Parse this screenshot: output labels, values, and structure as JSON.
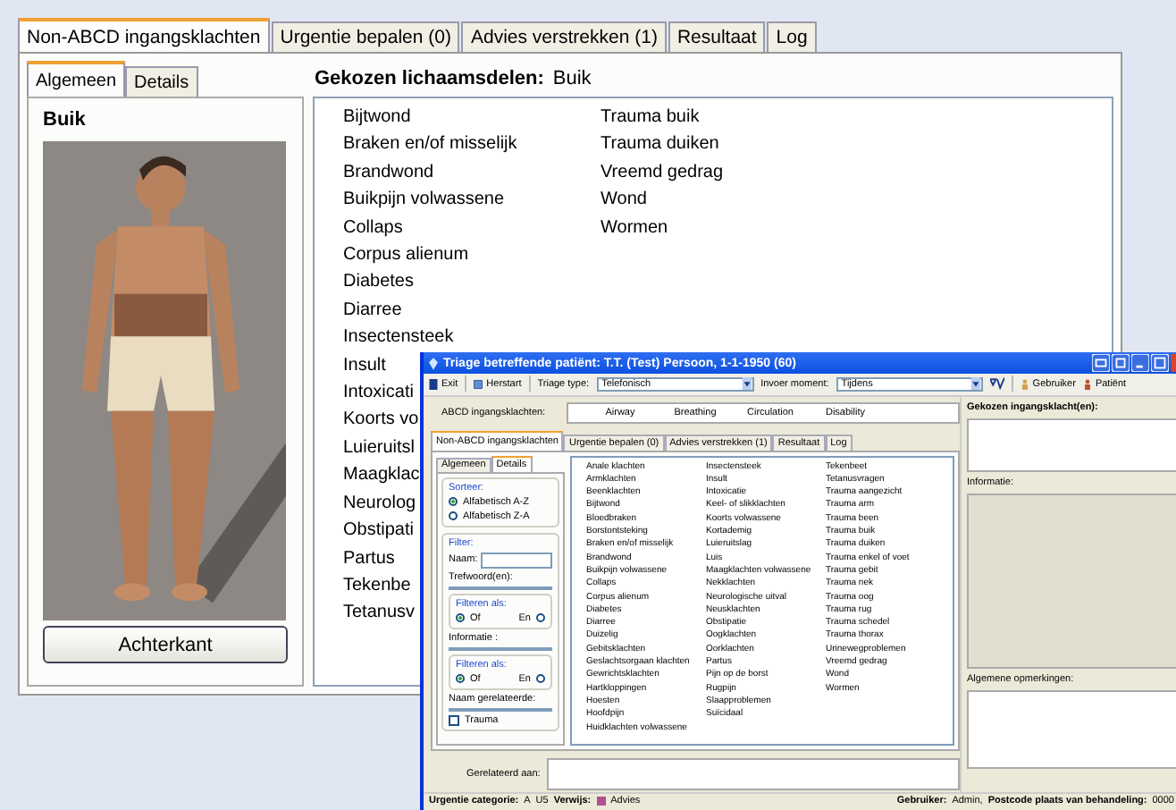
{
  "main_window": {
    "tabs": [
      {
        "label": "Non-ABCD ingangsklachten",
        "selected": true
      },
      {
        "label": "Urgentie bepalen (0)",
        "selected": false
      },
      {
        "label": "Advies verstrekken (1)",
        "selected": false
      },
      {
        "label": "Resultaat",
        "selected": false
      },
      {
        "label": "Log",
        "selected": false
      }
    ],
    "sub_tabs": [
      {
        "label": "Algemeen",
        "selected": true
      },
      {
        "label": "Details",
        "selected": false
      }
    ],
    "body_part_title": "Buik",
    "back_button": "Achterkant",
    "chosen_label": "Gekozen lichaamsdelen:",
    "chosen_value": "Buik",
    "complaint_columns": [
      [
        "Bijtwond",
        "Braken en/of misselijk",
        "Brandwond",
        "Buikpijn volwassene",
        "Collaps",
        "Corpus alienum",
        "Diabetes",
        "Diarree",
        "Insectensteek",
        "Insult",
        "Intoxicati",
        "Koorts vo",
        "Luieruitsl",
        "Maagklac",
        "Neurolog",
        "Obstipati",
        "Partus",
        "Tekenbe",
        "Tetanusv"
      ],
      [
        "Trauma buik",
        "Trauma duiken",
        "Vreemd gedrag",
        "Wond",
        "Wormen"
      ]
    ]
  },
  "triage_window": {
    "title": "Triage betreffende patiënt: T.T. (Test) Persoon, 1-1-1950 (60)",
    "toolbar": {
      "exit": "Exit",
      "restart": "Herstart",
      "triage_type_label": "Triage type:",
      "triage_type_value": "Telefonisch",
      "moment_label": "Invoer moment:",
      "moment_value": "Tijdens",
      "user": "Gebruiker",
      "patient": "Patiënt"
    },
    "abcd_label": "ABCD ingangsklachten:",
    "abcd_items": [
      "Airway",
      "Breathing",
      "Circulation",
      "Disability"
    ],
    "tabs": [
      {
        "label": "Non-ABCD ingangsklachten",
        "selected": true
      },
      {
        "label": "Urgentie bepalen (0)",
        "selected": false
      },
      {
        "label": "Advies verstrekken (1)",
        "selected": false
      },
      {
        "label": "Resultaat",
        "selected": false
      },
      {
        "label": "Log",
        "selected": false
      }
    ],
    "sub_tabs": [
      {
        "label": "Algemeen",
        "selected": false
      },
      {
        "label": "Details",
        "selected": true
      }
    ],
    "sort_group": {
      "title": "Sorteer:",
      "options": [
        {
          "label": "Alfabetisch A-Z",
          "selected": true
        },
        {
          "label": "Alfabetisch Z-A",
          "selected": false
        }
      ]
    },
    "filter_group": {
      "title": "Filter:",
      "name_label": "Naam:",
      "keywords_label": "Trefwoord(en):",
      "filter_as_1": {
        "title": "Filteren als:",
        "options": [
          {
            "label": "Of",
            "selected": true
          },
          {
            "label": "En",
            "selected": false
          }
        ]
      },
      "info_label": "Informatie :",
      "filter_as_2": {
        "title": "Filteren als:",
        "options": [
          {
            "label": "Of",
            "selected": true
          },
          {
            "label": "En",
            "selected": false
          }
        ]
      },
      "related_name_label": "Naam gerelateerde:",
      "trauma": {
        "label": "Trauma",
        "checked": false
      }
    },
    "complaint_columns": [
      [
        "Anale klachten",
        "Armklachten",
        "Beenklachten",
        "Bijtwond",
        "Bloedbraken",
        "Borstontsteking",
        "Braken en/of misselijk",
        "Brandwond",
        "Buikpijn volwassene",
        "Collaps",
        "Corpus alienum",
        "Diabetes",
        "Diarree",
        "Duizelig",
        "Gebitsklachten",
        "Geslachtsorgaan klachten",
        "Gewrichtsklachten",
        "Hartkloppingen",
        "Hoesten",
        "Hoofdpijn",
        "Huidklachten volwassene"
      ],
      [
        "Insectensteek",
        "Insult",
        "Intoxicatie",
        "Keel- of slikklachten",
        "Koorts volwassene",
        "Kortademig",
        "Luieruitslag",
        "Luis",
        "Maagklachten volwassene",
        "Nekklachten",
        "Neurologische uitval",
        "Neusklachten",
        "Obstipatie",
        "Oogklachten",
        "Oorklachten",
        "Partus",
        "Pijn op de borst",
        "Rugpijn",
        "Slaapproblemen",
        "Suïcidaal"
      ],
      [
        "Tekenbeet",
        "Tetanusvragen",
        "Trauma aangezicht",
        "Trauma arm",
        "Trauma been",
        "Trauma buik",
        "Trauma duiken",
        "Trauma enkel of voet",
        "Trauma gebit",
        "Trauma nek",
        "Trauma oog",
        "Trauma rug",
        "Trauma schedel",
        "Trauma thorax",
        "Urinewegproblemen",
        "Vreemd gedrag",
        "Wond",
        "Wormen"
      ]
    ],
    "side": {
      "chosen_label": "Gekozen ingangsklacht(en):",
      "info_label": "Informatie:",
      "remarks_label": "Algemene opmerkingen:"
    },
    "related_label": "Gerelateerd aan:",
    "status": {
      "urgency_label": "Urgentie categorie:",
      "urgency_code": "A",
      "urgency_value": "U5",
      "refer_label": "Verwijs:",
      "refer_value": "Advies",
      "user_label": "Gebruiker:",
      "user_value": "Admin,",
      "postcode_label": "Postcode plaats van behandeling:",
      "postcode_value": "0000"
    }
  }
}
